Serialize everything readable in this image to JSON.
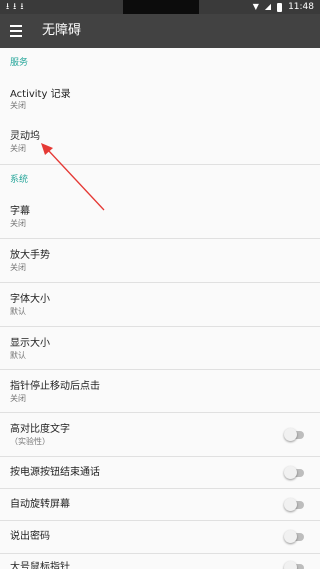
{
  "status_bar": {
    "notification_icons": [
      "download-icon",
      "download-icon",
      "download-icon"
    ],
    "time": "11:48",
    "icons": [
      "wifi-icon",
      "signal-icon",
      "battery-icon"
    ]
  },
  "toolbar": {
    "menu_icon": "menu-icon",
    "title": "无障碍"
  },
  "sections": {
    "services": "服务",
    "system": "系统"
  },
  "items": {
    "activity": {
      "title": "Activity 记录",
      "subtitle": "关闭"
    },
    "lingdongwu": {
      "title": "灵动坞",
      "subtitle": "关闭"
    },
    "captions": {
      "title": "字幕",
      "subtitle": "关闭"
    },
    "magnify": {
      "title": "放大手势",
      "subtitle": "关闭"
    },
    "font_size": {
      "title": "字体大小",
      "subtitle": "默认"
    },
    "display_size": {
      "title": "显示大小",
      "subtitle": "默认"
    },
    "dwell_click": {
      "title": "指针停止移动后点击",
      "subtitle": "关闭"
    },
    "high_contrast": {
      "title": "高对比度文字",
      "subtitle": "（实验性）",
      "enabled": false
    },
    "power_end_call": {
      "title": "按电源按钮结束通话",
      "enabled": false
    },
    "auto_rotate": {
      "title": "自动旋转屏幕",
      "enabled": false
    },
    "speak_password": {
      "title": "说出密码",
      "enabled": false
    },
    "large_pointer": {
      "title": "大号鼠标指针",
      "enabled": false
    }
  },
  "annotation": {
    "color": "#e53935"
  }
}
